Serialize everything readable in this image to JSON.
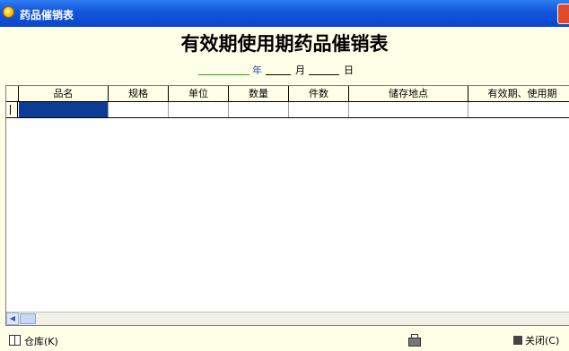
{
  "window": {
    "title": "药品催销表"
  },
  "report": {
    "title": "有效期使用期药品催销表",
    "date_labels": {
      "year": "年",
      "month": "月",
      "day": "日"
    }
  },
  "table": {
    "columns": [
      "品名",
      "规格",
      "单位",
      "数量",
      "件数",
      "储存地点",
      "有效期、使用期"
    ],
    "rows": [
      [
        "",
        "",
        "",
        "",
        "",
        "",
        ""
      ]
    ]
  },
  "bottom_bar": {
    "warehouse_label": "仓库(K)",
    "close_label": "关闭(C)"
  },
  "colors": {
    "titlebar": "#1155dd",
    "background": "#ffffe8",
    "selected_cell": "#0c3c96",
    "year_underline": "#22aa22",
    "year_label": "#1a4db3"
  }
}
